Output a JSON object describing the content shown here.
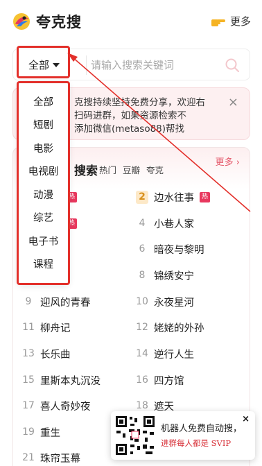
{
  "app": {
    "title": "夸克搜",
    "more_label": "更多"
  },
  "search": {
    "category": "全部",
    "placeholder": "请输入搜索关键词"
  },
  "notice": {
    "lines": [
      "克搜持续坚持免费分享，欢迎右",
      "扫码进群，如果资源检索不",
      "添加微信(metaso88)帮找"
    ],
    "close": "×"
  },
  "hot": {
    "title": "搜索",
    "tabs": [
      "热门",
      "豆瓣",
      "夸克"
    ],
    "more": "更多 ›",
    "hot_tag": "热",
    "left": [
      {
        "rank": "",
        "title": ""
      },
      {
        "rank": "",
        "title": ""
      },
      {
        "rank": "",
        "title": ""
      },
      {
        "rank": "",
        "title": ""
      },
      {
        "rank": "9",
        "title": "迎风的青春"
      },
      {
        "rank": "11",
        "title": "柳舟记"
      },
      {
        "rank": "13",
        "title": "长乐曲"
      },
      {
        "rank": "15",
        "title": "里斯本丸沉没"
      },
      {
        "rank": "17",
        "title": "喜人奇妙夜"
      },
      {
        "rank": "19",
        "title": "重生"
      },
      {
        "rank": "21",
        "title": "珠帘玉幕"
      }
    ],
    "right": [
      {
        "rank": "2",
        "title": "边水往事"
      },
      {
        "rank": "4",
        "title": "小巷人家"
      },
      {
        "rank": "6",
        "title": "暗夜与黎明"
      },
      {
        "rank": "8",
        "title": "锦绣安宁"
      },
      {
        "rank": "10",
        "title": "永夜星河"
      },
      {
        "rank": "12",
        "title": "姥姥的外孙"
      },
      {
        "rank": "14",
        "title": "逆行人生"
      },
      {
        "rank": "16",
        "title": "四方馆"
      },
      {
        "rank": "18",
        "title": "遮天"
      }
    ]
  },
  "dropdown": {
    "items": [
      "全部",
      "短剧",
      "电影",
      "电视剧",
      "动漫",
      "综艺",
      "电子书",
      "课程"
    ]
  },
  "promo": {
    "line1": "机器人免费自动搜，",
    "line2": "进群每人都是 SVIP",
    "close": "×"
  },
  "colors": {
    "accent": "#e4586a",
    "annotation": "#e3302b",
    "hot_tag": "#e8385e"
  }
}
